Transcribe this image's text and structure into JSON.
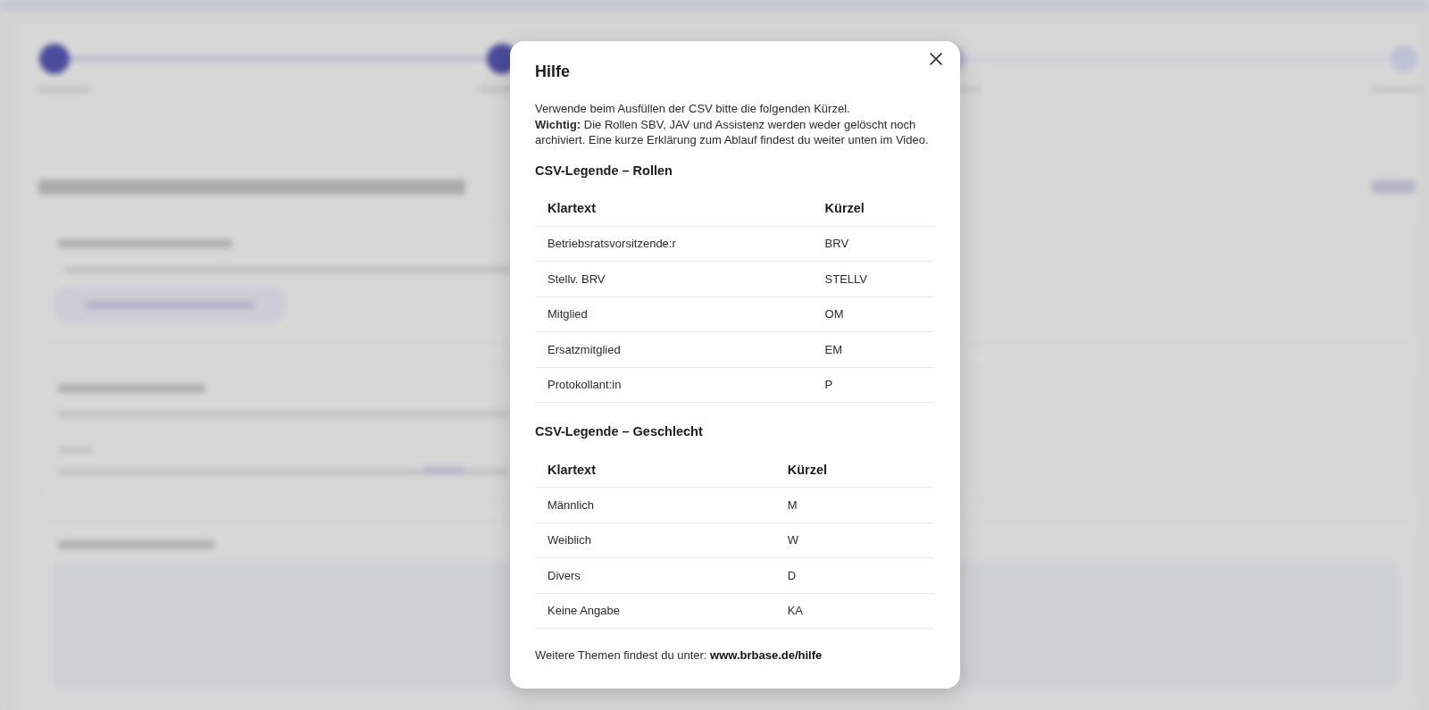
{
  "dialog": {
    "title": "Hilfe",
    "intro": "Verwende beim Ausfüllen der CSV bitte die folgenden Kürzel.",
    "note": "**Wichtig:** Die Rollen SBV, JAV und Assistenz werden weder gelöscht noch archiviert. Eine kurze Erklärung zum Ablauf findest du weiter unten im Video.",
    "sections": [
      {
        "title": "CSV-Legende – Rollen",
        "table": {
          "columns": [
            "Klartext",
            "Kürzel"
          ],
          "rows": [
            [
              "Betriebsratsvorsitzende:r",
              "BRV"
            ],
            [
              "Stellv. BRV",
              "STELLV"
            ],
            [
              "Mitglied",
              "OM"
            ],
            [
              "Ersatzmitglied",
              "EM"
            ],
            [
              "Protokollant:in",
              "P"
            ]
          ]
        }
      },
      {
        "title": "CSV-Legende – Geschlecht",
        "table": {
          "columns": [
            "Klartext",
            "Kürzel"
          ],
          "rows": [
            [
              "Männlich",
              "M"
            ],
            [
              "Weiblich",
              "W"
            ],
            [
              "Divers",
              "D"
            ],
            [
              "Keine Angabe",
              "KA"
            ]
          ]
        }
      }
    ],
    "footer": {
      "text": "Weitere Themen findest du unter:",
      "link": "www.brbase.de/hilfe"
    }
  }
}
